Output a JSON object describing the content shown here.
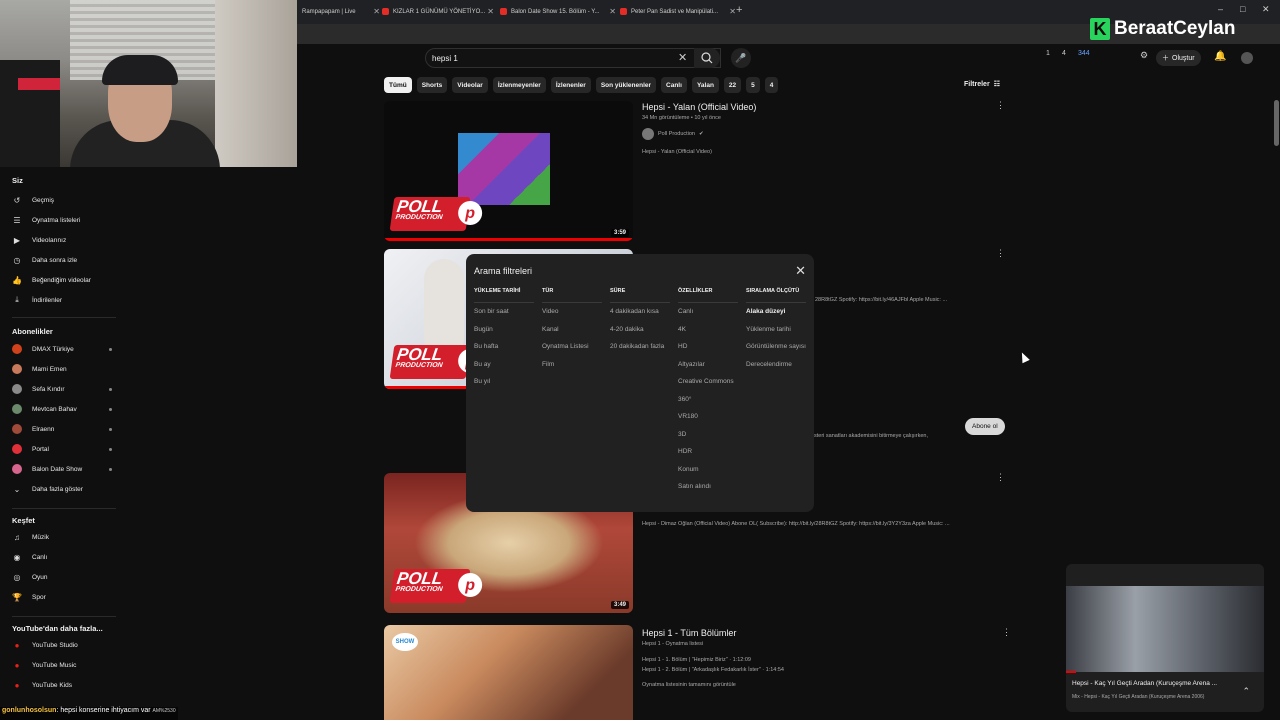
{
  "browser": {
    "tabs": [
      {
        "label": "Rampapapam | Live"
      },
      {
        "label": "KIZLAR 1 GÜNÜMÜ YÖNETİYO..."
      },
      {
        "label": "Balon Date Show 15. Bölüm - Y..."
      },
      {
        "label": "Peter Pan Sadist ve Manipülati..."
      }
    ],
    "new_tab": "+",
    "window_controls": [
      "–",
      "□",
      "✕"
    ]
  },
  "overlay": {
    "logo_letter": "K",
    "logo_text": "BeraatCeylan",
    "chat_user": "gonlunhosolsun",
    "chat_message": ": hepsi konserine ihtiyacım var",
    "chat_tail": "AM%2530"
  },
  "header": {
    "search_value": "hepsi 1",
    "create_label": "Oluştur",
    "stats": [
      "1",
      "4",
      "344"
    ]
  },
  "chips": [
    "Tümü",
    "Shorts",
    "Videolar",
    "İzlenmeyenler",
    "İzlenenler",
    "Son yüklenenler",
    "Canlı",
    "Yalan",
    "22",
    "5",
    "4"
  ],
  "filters_label": "Filtreler",
  "sidebar": {
    "you_label": "Siz",
    "you_items": [
      {
        "label": "Geçmiş",
        "icon": "history-icon",
        "glyph": "↺"
      },
      {
        "label": "Oynatma listeleri",
        "icon": "playlist-icon",
        "glyph": "☰"
      },
      {
        "label": "Videolarınız",
        "icon": "your-videos-icon",
        "glyph": "▶"
      },
      {
        "label": "Daha sonra izle",
        "icon": "watch-later-icon",
        "glyph": "◷"
      },
      {
        "label": "Beğendiğim videolar",
        "icon": "like-icon",
        "glyph": "👍"
      },
      {
        "label": "İndirilenler",
        "icon": "download-icon",
        "glyph": "⤓"
      }
    ],
    "subs_label": "Abonelikler",
    "subs": [
      {
        "label": "DMAX Türkiye",
        "color": "#d0421b",
        "dot": true
      },
      {
        "label": "Mami Emen",
        "color": "#c97a5c",
        "dot": false
      },
      {
        "label": "Sefa Kındır",
        "color": "#8a8a8a",
        "dot": true
      },
      {
        "label": "Mevtcan Bahav",
        "color": "#6b8a6b",
        "dot": true
      },
      {
        "label": "Elraenn",
        "color": "#a04a3a",
        "dot": true
      },
      {
        "label": "Portal",
        "color": "#e0303a",
        "dot": true
      },
      {
        "label": "Balon Date Show",
        "color": "#d8658e",
        "dot": true
      }
    ],
    "show_more": "Daha fazla göster",
    "explore_label": "Keşfet",
    "explore": [
      {
        "label": "Müzik",
        "icon": "music-icon",
        "glyph": "♫"
      },
      {
        "label": "Canlı",
        "icon": "live-icon",
        "glyph": "◉"
      },
      {
        "label": "Oyun",
        "icon": "gaming-icon",
        "glyph": "◎"
      },
      {
        "label": "Spor",
        "icon": "sports-icon",
        "glyph": "🏆"
      }
    ],
    "more_label": "YouTube'dan daha fazla...",
    "more": [
      {
        "label": "YouTube Studio"
      },
      {
        "label": "YouTube Music"
      },
      {
        "label": "YouTube Kids"
      }
    ]
  },
  "results": [
    {
      "title": "Hepsi - Yalan (Official Video)",
      "meta": "34 Mn görüntüleme • 10 yıl önce",
      "channel": "Poll Production",
      "desc": "Hepsi - Yalan (Official Video)",
      "duration": "3:59"
    },
    {
      "title": "",
      "desc": "28R8tGZ Spotify: https://bit.ly/46AJFbl Apple Music: ...",
      "desc2": "steri sanatları akademisini bitirmeye çalışırken,",
      "subscribe": "Abone ol"
    },
    {
      "desc": "Hepsi - Dimaz Oğlan (Official Video) Abone OL( Subscribe): http://bit.ly/28R8tGZ Spotify: https://bit.ly/3Y2Y3za Apple Music: ...",
      "duration": "3:49"
    },
    {
      "title": "Hepsi 1 - Tüm Bölümler",
      "meta": "Hepsi 1 - Oynatma listesi",
      "lines": [
        "Hepsi 1 - 1. Bölüm | \"Hepimiz Biriz\" · 1:12:09",
        "Hepsi 1 - 2. Bölüm | \"Arkadaşlık Fedakarlık İster\" · 1:14:54"
      ],
      "link": "Oynatma listesinin tamamını görüntüle"
    }
  ],
  "poll_logo": {
    "big": "POLL",
    "small": "PRODUCTION",
    "p": "p"
  },
  "modal": {
    "title": "Arama filtreleri",
    "columns": [
      {
        "header": "YÜKLEME TARİHİ",
        "options": [
          "Son bir saat",
          "Bugün",
          "Bu hafta",
          "Bu ay",
          "Bu yıl"
        ],
        "selected": -1
      },
      {
        "header": "TÜR",
        "options": [
          "Video",
          "Kanal",
          "Oynatma Listesi",
          "Film"
        ],
        "selected": -1
      },
      {
        "header": "SÜRE",
        "options": [
          "4 dakikadan kısa",
          "4-20 dakika",
          "20 dakikadan fazla"
        ],
        "selected": -1
      },
      {
        "header": "ÖZELLİKLER",
        "options": [
          "Canlı",
          "4K",
          "HD",
          "Altyazılar",
          "Creative Commons",
          "360°",
          "VR180",
          "3D",
          "HDR",
          "Konum",
          "Satın alındı"
        ],
        "selected": -1
      },
      {
        "header": "SIRALAMA ÖLÇÜTÜ",
        "options": [
          "Alaka düzeyi",
          "Yüklenme tarihi",
          "Görüntülenme sayısı",
          "Derecelendirme"
        ],
        "selected": 0
      }
    ]
  },
  "miniplayer": {
    "title": "Hepsi - Kaç Yıl Geçti Aradan (Kuruçeşme Arena ...",
    "subtitle": "Mix - Hepsi - Kaç Yıl Geçti Aradan (Kuruçeşme Arena 2006)"
  }
}
